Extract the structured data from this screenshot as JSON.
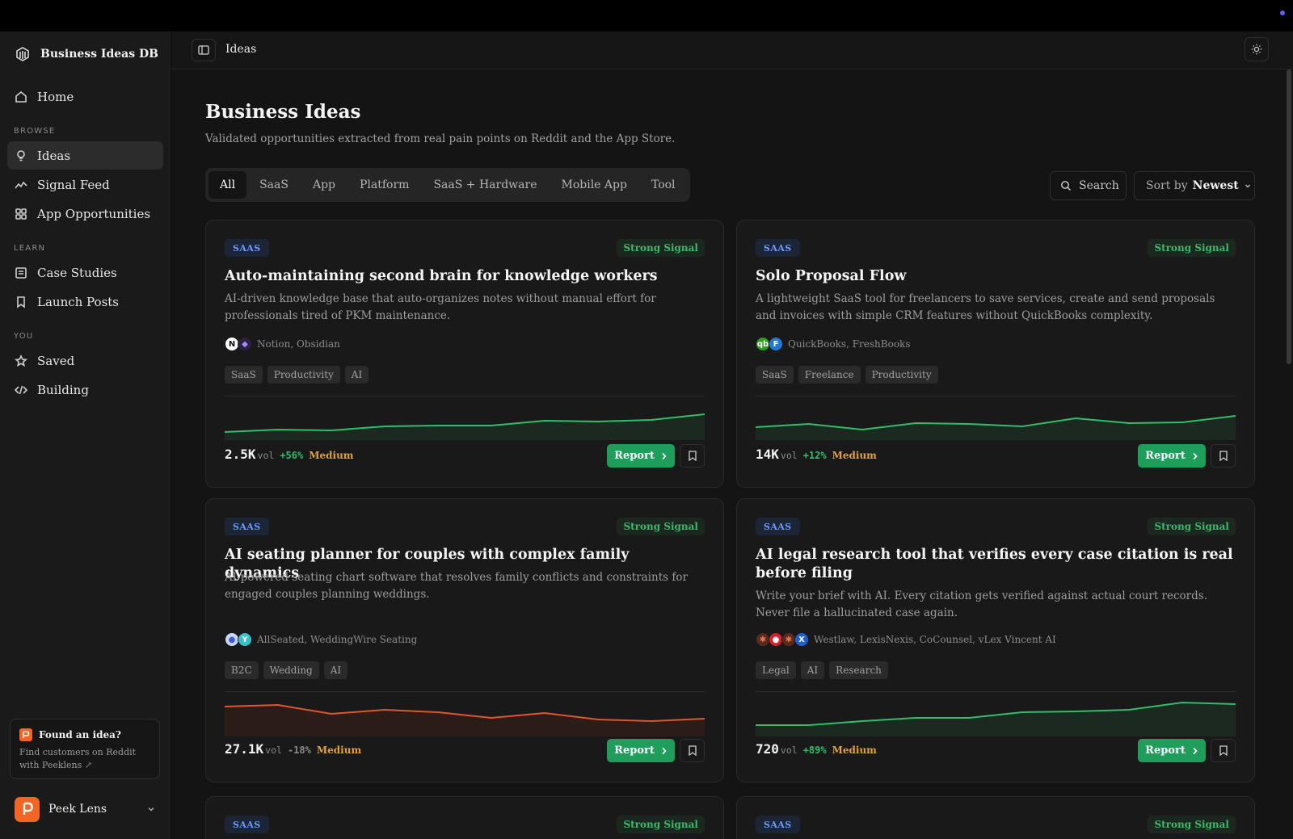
{
  "app": {
    "name": "Business Ideas DB"
  },
  "sidebar": {
    "home": "Home",
    "sections": {
      "browse": "BROWSE",
      "learn": "LEARN",
      "you": "YOU"
    },
    "items": [
      {
        "label": "Ideas",
        "icon": "lightbulb-icon"
      },
      {
        "label": "Signal Feed",
        "icon": "trend-icon"
      },
      {
        "label": "App Opportunities",
        "icon": "grid-icon"
      },
      {
        "label": "Case Studies",
        "icon": "document-icon"
      },
      {
        "label": "Launch Posts",
        "icon": "bookmark-icon"
      },
      {
        "label": "Saved",
        "icon": "star-icon"
      },
      {
        "label": "Building",
        "icon": "code-icon"
      }
    ],
    "promo": {
      "title": "Found an idea?",
      "text": "Find customers on Reddit with Peeklens ↗"
    },
    "user": {
      "name": "Peek Lens"
    }
  },
  "header": {
    "breadcrumb": "Ideas"
  },
  "page": {
    "title": "Business Ideas",
    "subtitle": "Validated opportunities extracted from real pain points on Reddit and the App Store."
  },
  "filters": [
    "All",
    "SaaS",
    "App",
    "Platform",
    "SaaS + Hardware",
    "Mobile App",
    "Tool"
  ],
  "search": {
    "label": "Search"
  },
  "sort": {
    "label": "Sort by",
    "value": "Newest"
  },
  "colors": {
    "accent_green": "#1e9e5a",
    "signal_up": "#2fbf6b",
    "signal_down": "#e0552b",
    "badge_blue": "#6b9bff",
    "level_orange": "#e0a23c"
  },
  "cards": [
    {
      "type": "SAAS",
      "signal": "Strong Signal",
      "title": "Auto-maintaining second brain for knowledge workers",
      "description": "AI-driven knowledge base that auto-organizes notes without manual effort for professionals tired of PKM maintenance.",
      "competitors": "Notion, Obsidian",
      "tags": [
        "SaaS",
        "Productivity",
        "AI"
      ],
      "volume": "2.5K",
      "vol_unit": "vol",
      "growth": "+56%",
      "level": "Medium",
      "trend_direction": "up",
      "report": "Report"
    },
    {
      "type": "SAAS",
      "signal": "Strong Signal",
      "title": "Solo Proposal Flow",
      "description": "A lightweight SaaS tool for freelancers to save services, create and send proposals and invoices with simple CRM features without QuickBooks complexity.",
      "competitors": "QuickBooks, FreshBooks",
      "tags": [
        "SaaS",
        "Freelance",
        "Productivity"
      ],
      "volume": "14K",
      "vol_unit": "vol",
      "growth": "+12%",
      "level": "Medium",
      "trend_direction": "up",
      "report": "Report"
    },
    {
      "type": "SAAS",
      "signal": "Strong Signal",
      "title": "AI seating planner for couples with complex family dynamics",
      "description": "AI-powered seating chart software that resolves family conflicts and constraints for engaged couples planning weddings.",
      "competitors": "AllSeated, WeddingWire Seating",
      "tags": [
        "B2C",
        "Wedding",
        "AI"
      ],
      "volume": "27.1K",
      "vol_unit": "vol",
      "growth": "-18%",
      "level": "Medium",
      "trend_direction": "down",
      "report": "Report"
    },
    {
      "type": "SAAS",
      "signal": "Strong Signal",
      "title": "AI legal research tool that verifies every case citation is real before filing",
      "description": "Write your brief with AI. Every citation gets verified against actual court records. Never file a hallucinated case again.",
      "competitors": "Westlaw, LexisNexis, CoCounsel, vLex Vincent AI",
      "tags": [
        "Legal",
        "AI",
        "Research"
      ],
      "volume": "720",
      "vol_unit": "vol",
      "growth": "+89%",
      "level": "Medium",
      "trend_direction": "up",
      "report": "Report"
    },
    {
      "type": "SAAS",
      "signal": "Strong Signal"
    },
    {
      "type": "SAAS",
      "signal": "Strong Signal"
    }
  ]
}
